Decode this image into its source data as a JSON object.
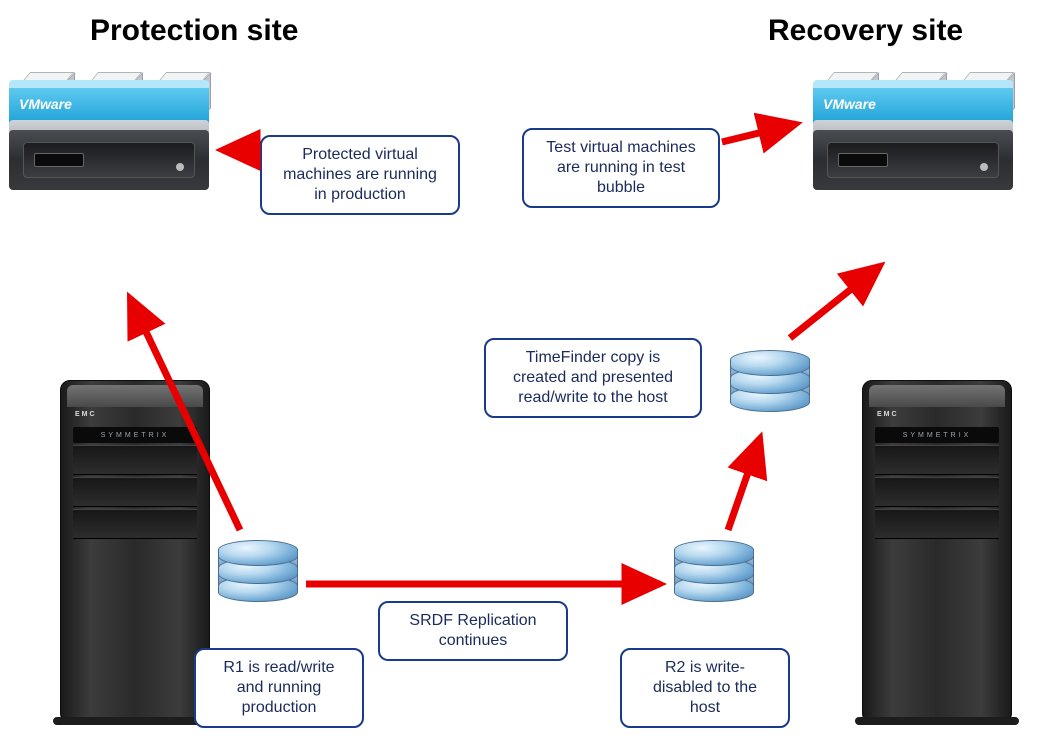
{
  "titles": {
    "protection": "Protection site",
    "recovery": "Recovery site"
  },
  "callouts": {
    "protected_vm": "Protected virtual machines are running in production",
    "test_vm": "Test virtual machines are running in test bubble",
    "timefinder": "TimeFinder copy is created and presented read/write to the host",
    "srdf": "SRDF Replication continues",
    "r1": "R1 is read/write and running production",
    "r2": "R2 is write-disabled to the host"
  },
  "labels": {
    "vmware": "VMware",
    "vm": "VM",
    "emc": "EMC",
    "symmetrix": "SYMMETRIX"
  }
}
